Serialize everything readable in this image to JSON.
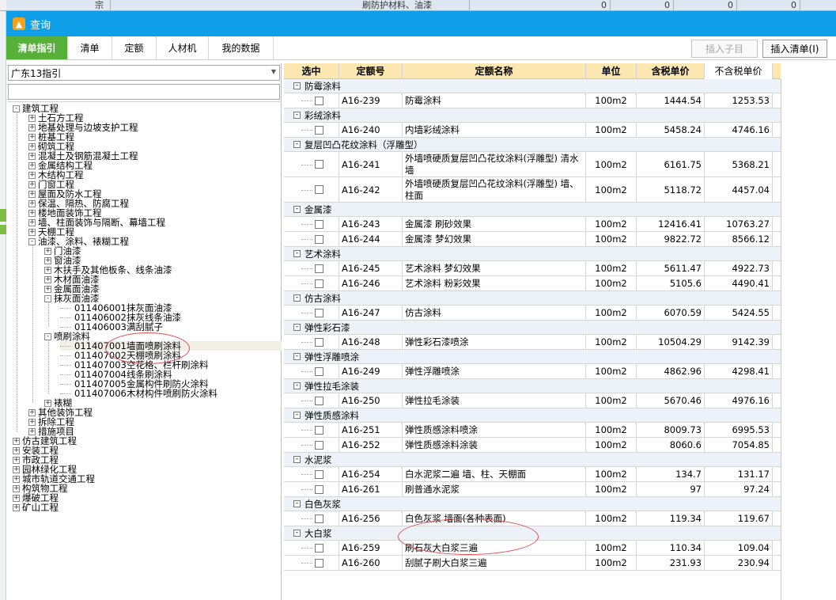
{
  "background_app": {
    "cells": [
      "宗",
      "刷防护材料、油漆",
      "0",
      "0",
      "0",
      "0"
    ]
  },
  "window": {
    "title": "查询",
    "icon": "app-logo-icon"
  },
  "tabs": [
    {
      "label": "清单指引",
      "active": true
    },
    {
      "label": "清单",
      "active": false
    },
    {
      "label": "定额",
      "active": false
    },
    {
      "label": "人材机",
      "active": false
    },
    {
      "label": "我的数据",
      "active": false
    }
  ],
  "toolbar": {
    "insert_child_label": "插入子目",
    "insert_list_label": "插入清单(I)"
  },
  "left": {
    "index_select": "广东13指引",
    "filter_placeholder": ""
  },
  "tree": [
    {
      "level": 0,
      "expander": "-",
      "label": "建筑工程"
    },
    {
      "level": 1,
      "expander": "+",
      "label": "土石方工程"
    },
    {
      "level": 1,
      "expander": "+",
      "label": "地基处理与边坡支护工程"
    },
    {
      "level": 1,
      "expander": "+",
      "label": "桩基工程"
    },
    {
      "level": 1,
      "expander": "+",
      "label": "砌筑工程"
    },
    {
      "level": 1,
      "expander": "+",
      "label": "混凝土及钢筋混凝土工程"
    },
    {
      "level": 1,
      "expander": "+",
      "label": "金属结构工程"
    },
    {
      "level": 1,
      "expander": "+",
      "label": "木结构工程"
    },
    {
      "level": 1,
      "expander": "+",
      "label": "门窗工程"
    },
    {
      "level": 1,
      "expander": "+",
      "label": "屋面及防水工程"
    },
    {
      "level": 1,
      "expander": "+",
      "label": "保温、隔热、防腐工程"
    },
    {
      "level": 1,
      "expander": "+",
      "label": "楼地面装饰工程"
    },
    {
      "level": 1,
      "expander": "+",
      "label": "墙、柱面装饰与隔断、幕墙工程"
    },
    {
      "level": 1,
      "expander": "+",
      "label": "天棚工程"
    },
    {
      "level": 1,
      "expander": "-",
      "label": "油漆、涂料、裱糊工程"
    },
    {
      "level": 2,
      "expander": "+",
      "label": "门油漆"
    },
    {
      "level": 2,
      "expander": "+",
      "label": "窗油漆"
    },
    {
      "level": 2,
      "expander": "+",
      "label": "木扶手及其他板条、线条油漆"
    },
    {
      "level": 2,
      "expander": "+",
      "label": "木材面油漆"
    },
    {
      "level": 2,
      "expander": "+",
      "label": "金属面油漆"
    },
    {
      "level": 2,
      "expander": "-",
      "label": "抹灰面油漆"
    },
    {
      "level": 3,
      "expander": "",
      "code": "011406001",
      "label": "抹灰面油漆"
    },
    {
      "level": 3,
      "expander": "",
      "code": "011406002",
      "label": "抹灰线条油漆"
    },
    {
      "level": 3,
      "expander": "",
      "code": "011406003",
      "label": "满刮腻子"
    },
    {
      "level": 2,
      "expander": "-",
      "label": "喷刷涂料"
    },
    {
      "level": 3,
      "expander": "",
      "code": "011407001",
      "label": "墙面喷刷涂料",
      "selected": true
    },
    {
      "level": 3,
      "expander": "",
      "code": "011407002",
      "label": "天棚喷刷涂料"
    },
    {
      "level": 3,
      "expander": "",
      "code": "011407003",
      "label": "空花格、栏杆刷涂料"
    },
    {
      "level": 3,
      "expander": "",
      "code": "011407004",
      "label": "线条刷涂料"
    },
    {
      "level": 3,
      "expander": "",
      "code": "011407005",
      "label": "金属构件刷防火涂料"
    },
    {
      "level": 3,
      "expander": "",
      "code": "011407006",
      "label": "木材构件喷刷防火涂料"
    },
    {
      "level": 2,
      "expander": "+",
      "label": "裱糊"
    },
    {
      "level": 1,
      "expander": "+",
      "label": "其他装饰工程"
    },
    {
      "level": 1,
      "expander": "+",
      "label": "拆除工程"
    },
    {
      "level": 1,
      "expander": "+",
      "label": "措施项目"
    },
    {
      "level": 0,
      "expander": "+",
      "label": "仿古建筑工程"
    },
    {
      "level": 0,
      "expander": "+",
      "label": "安装工程"
    },
    {
      "level": 0,
      "expander": "+",
      "label": "市政工程"
    },
    {
      "level": 0,
      "expander": "+",
      "label": "园林绿化工程"
    },
    {
      "level": 0,
      "expander": "+",
      "label": "城市轨道交通工程"
    },
    {
      "level": 0,
      "expander": "+",
      "label": "构筑物工程"
    },
    {
      "level": 0,
      "expander": "+",
      "label": "爆破工程"
    },
    {
      "level": 0,
      "expander": "+",
      "label": "矿山工程"
    }
  ],
  "grid": {
    "columns": [
      "选中",
      "定额号",
      "定额名称",
      "单位",
      "含税单价",
      "不含税单价"
    ],
    "rows": [
      {
        "group": "防霉涂料"
      },
      {
        "code": "A16-239",
        "name": "防霉涂料",
        "unit": "100m2",
        "tax_price": "1444.54",
        "notax_price": "1253.53"
      },
      {
        "group": "彩绒涂料"
      },
      {
        "code": "A16-240",
        "name": "内墙彩绒涂料",
        "unit": "100m2",
        "tax_price": "5458.24",
        "notax_price": "4746.16"
      },
      {
        "group": "复层凹凸花纹涂料（浮雕型）"
      },
      {
        "code": "A16-241",
        "name": "外墙喷硬质复层凹凸花纹涂料(浮雕型) 清水墙",
        "unit": "100m2",
        "tax_price": "6161.75",
        "notax_price": "5368.21",
        "tall": true
      },
      {
        "code": "A16-242",
        "name": "外墙喷硬质复层凹凸花纹涂料(浮雕型) 墙、柱面",
        "unit": "100m2",
        "tax_price": "5118.72",
        "notax_price": "4457.04",
        "tall": true
      },
      {
        "group": "金属漆"
      },
      {
        "code": "A16-243",
        "name": "金属漆 刷砂效果",
        "unit": "100m2",
        "tax_price": "12416.41",
        "notax_price": "10763.27"
      },
      {
        "code": "A16-244",
        "name": "金属漆 梦幻效果",
        "unit": "100m2",
        "tax_price": "9822.72",
        "notax_price": "8566.12"
      },
      {
        "group": "艺术涂料"
      },
      {
        "code": "A16-245",
        "name": "艺术涂料 梦幻效果",
        "unit": "100m2",
        "tax_price": "5611.47",
        "notax_price": "4922.73"
      },
      {
        "code": "A16-246",
        "name": "艺术涂料 粉彩效果",
        "unit": "100m2",
        "tax_price": "5105.6",
        "notax_price": "4490.41"
      },
      {
        "group": "仿古涂料"
      },
      {
        "code": "A16-247",
        "name": "仿古涂料",
        "unit": "100m2",
        "tax_price": "6070.59",
        "notax_price": "5424.55"
      },
      {
        "group": "弹性彩石漆"
      },
      {
        "code": "A16-248",
        "name": "弹性彩石漆喷涂",
        "unit": "100m2",
        "tax_price": "10504.29",
        "notax_price": "9142.39"
      },
      {
        "group": "弹性浮雕喷涂"
      },
      {
        "code": "A16-249",
        "name": "弹性浮雕喷涂",
        "unit": "100m2",
        "tax_price": "4862.96",
        "notax_price": "4298.41"
      },
      {
        "group": "弹性拉毛涂装"
      },
      {
        "code": "A16-250",
        "name": "弹性拉毛涂装",
        "unit": "100m2",
        "tax_price": "5670.46",
        "notax_price": "4976.16"
      },
      {
        "group": "弹性质感涂料"
      },
      {
        "code": "A16-251",
        "name": "弹性质感涂料喷涂",
        "unit": "100m2",
        "tax_price": "8009.73",
        "notax_price": "6995.53"
      },
      {
        "code": "A16-252",
        "name": "弹性质感涂料涂装",
        "unit": "100m2",
        "tax_price": "8060.6",
        "notax_price": "7054.85"
      },
      {
        "group": "水泥浆"
      },
      {
        "code": "A16-254",
        "name": "白水泥浆二遍 墙、柱、天棚面",
        "unit": "100m2",
        "tax_price": "134.7",
        "notax_price": "131.17"
      },
      {
        "code": "A16-261",
        "name": "刷普通水泥浆",
        "unit": "100m2",
        "tax_price": "97",
        "notax_price": "97.24"
      },
      {
        "group": "白色灰浆"
      },
      {
        "code": "A16-256",
        "name": "白色灰浆 墙面(各种表面)",
        "unit": "100m2",
        "tax_price": "119.34",
        "notax_price": "119.67"
      },
      {
        "group": "大白浆"
      },
      {
        "code": "A16-259",
        "name": "刷石灰大白浆三遍",
        "unit": "100m2",
        "tax_price": "110.34",
        "notax_price": "109.04"
      },
      {
        "code": "A16-260",
        "name": "刮腻子刷大白浆三遍",
        "unit": "100m2",
        "tax_price": "231.93",
        "notax_price": "230.94"
      }
    ]
  },
  "colors": {
    "titlebar": "#0f9fe8",
    "active_tab": "#57b038",
    "grid_header": "#fde7b0",
    "group_row": "#edf2f8",
    "annotation": "#e05050"
  }
}
